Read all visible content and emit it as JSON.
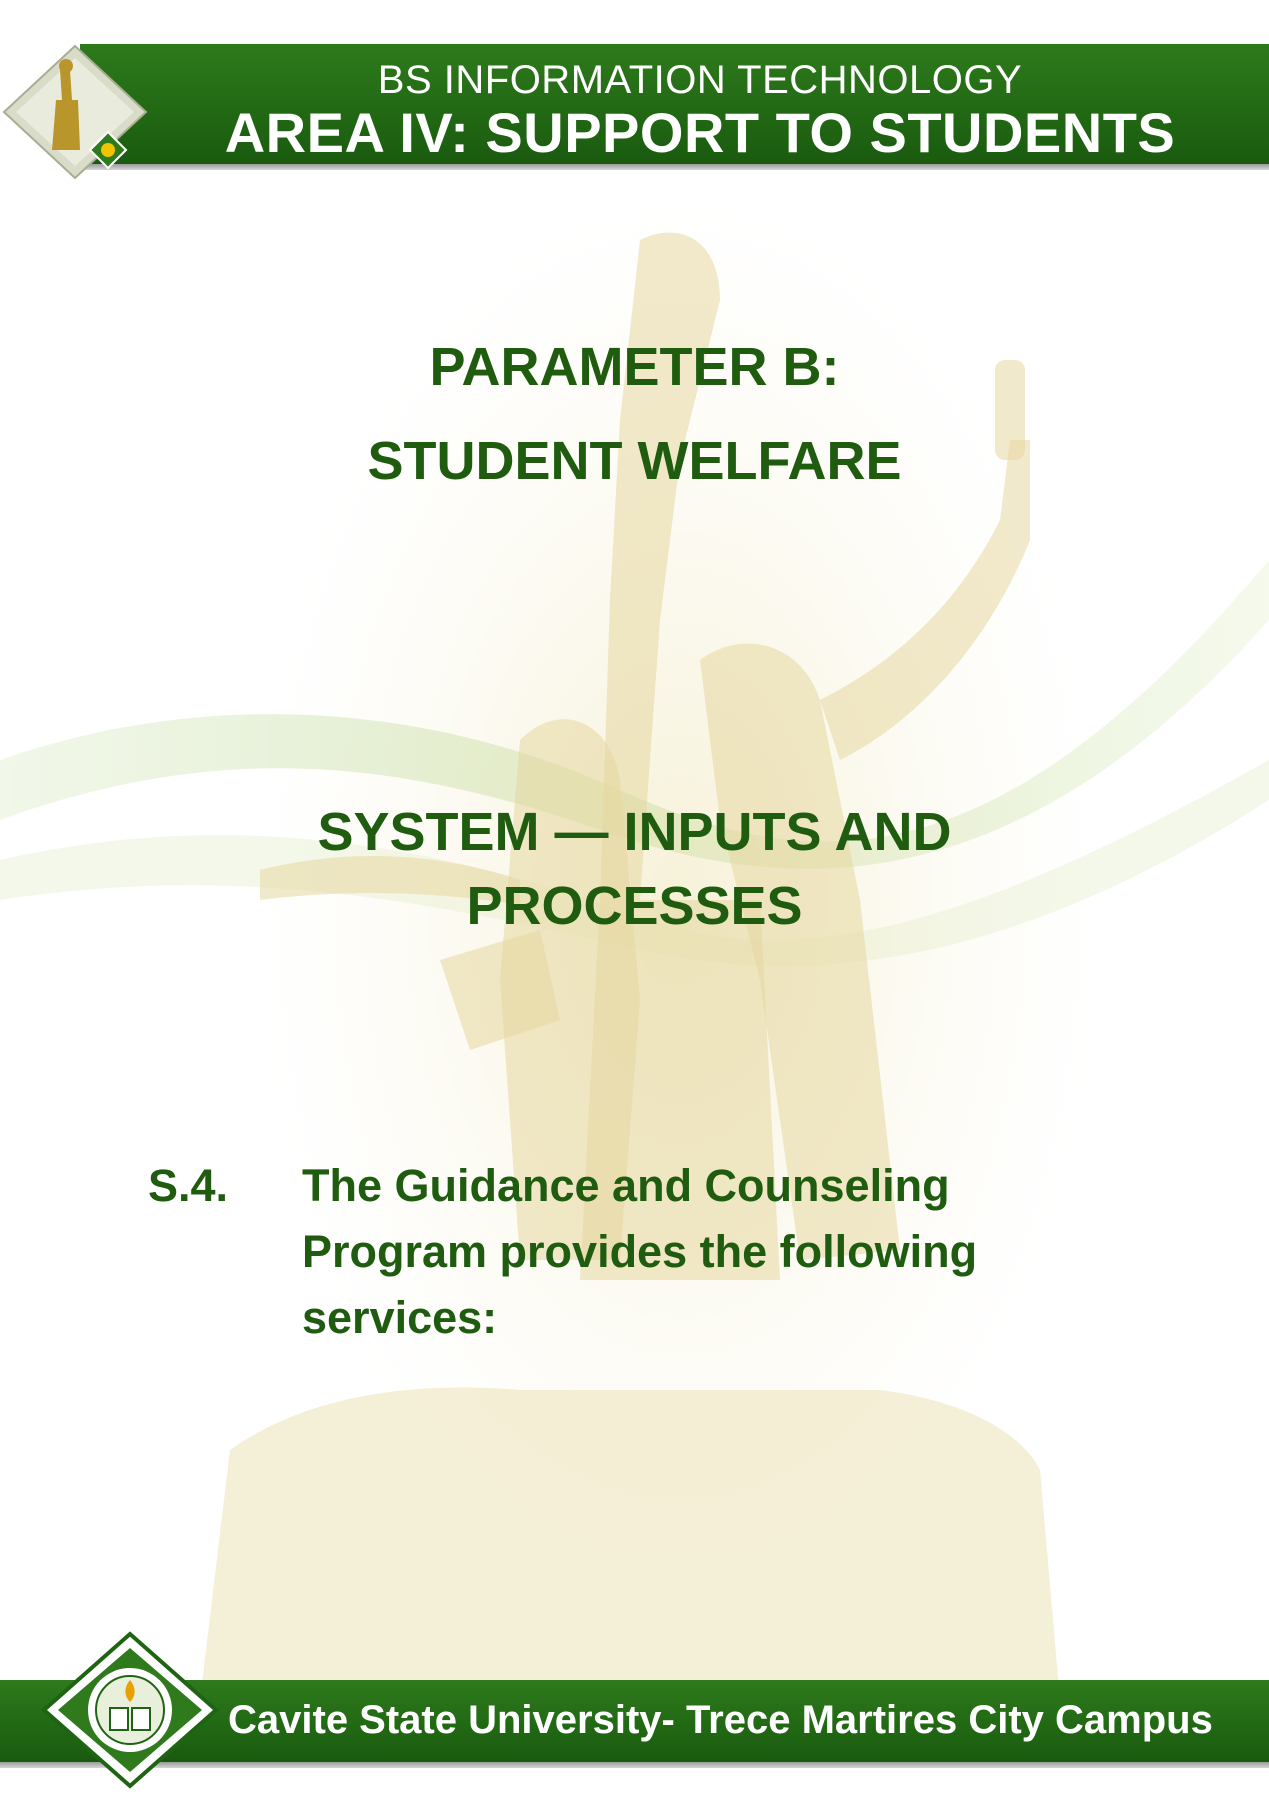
{
  "header": {
    "program": "BS INFORMATION TECHNOLOGY",
    "area_title": "AREA IV: SUPPORT TO STUDENTS"
  },
  "parameter": {
    "line1": "PARAMETER B:",
    "line2": "STUDENT WELFARE"
  },
  "section": {
    "line1": "SYSTEM — INPUTS AND",
    "line2": "PROCESSES"
  },
  "item": {
    "number": "S.4.",
    "line1": "The Guidance and Counseling",
    "line2": "Program provides the following",
    "line3": "services:"
  },
  "footer": {
    "campus": "Cavite State University- Trece Martires City Campus"
  },
  "colors": {
    "brand_green": "#1f6412",
    "heading_green": "#1f5c10",
    "header_text": "#ffffff"
  },
  "icons": [
    "monument-watermark",
    "university-logo-icon",
    "university-seal-icon"
  ]
}
